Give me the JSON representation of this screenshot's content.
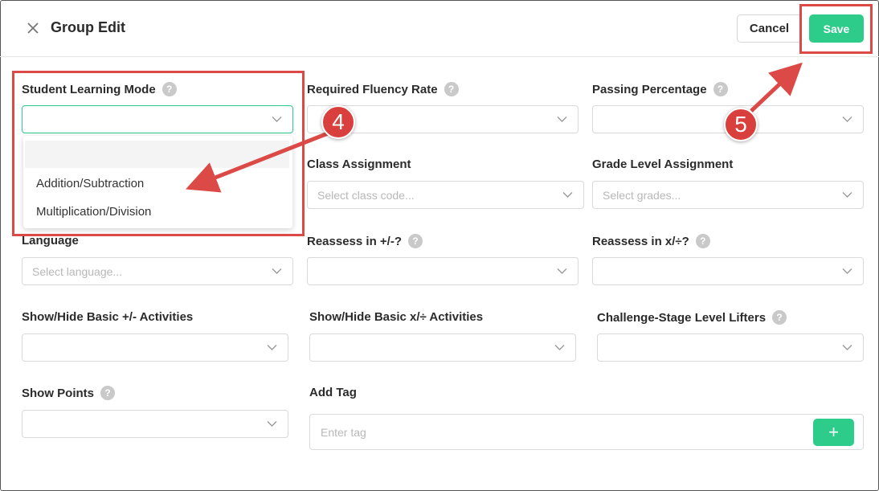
{
  "header": {
    "title": "Group Edit",
    "cancel_label": "Cancel",
    "save_label": "Save"
  },
  "fields": {
    "student_learning_mode": {
      "label": "Student Learning Mode",
      "help": "?",
      "value": ""
    },
    "required_fluency_rate": {
      "label": "Required Fluency Rate",
      "help": "?",
      "value": ""
    },
    "passing_percentage": {
      "label": "Passing Percentage",
      "help": "?",
      "value": ""
    },
    "class_assignment": {
      "label": "Class Assignment",
      "placeholder": "Select class code..."
    },
    "grade_level_assignment": {
      "label": "Grade Level Assignment",
      "placeholder": "Select grades..."
    },
    "language": {
      "label": "Language",
      "placeholder": "Select language..."
    },
    "reassess_add_sub": {
      "label": "Reassess in +/-?",
      "help": "?",
      "value": ""
    },
    "reassess_mul_div": {
      "label": "Reassess in x/÷?",
      "help": "?",
      "value": ""
    },
    "show_hide_basic_add_sub": {
      "label": "Show/Hide Basic +/- Activities",
      "value": ""
    },
    "show_hide_basic_mul_div": {
      "label": "Show/Hide Basic x/÷ Activities",
      "value": ""
    },
    "challenge_stage_level_lifters": {
      "label": "Challenge-Stage Level Lifters",
      "help": "?",
      "value": ""
    },
    "show_points": {
      "label": "Show Points",
      "help": "?",
      "value": ""
    },
    "add_tag": {
      "label": "Add Tag",
      "placeholder": "Enter tag",
      "button": "+"
    }
  },
  "dropdown": {
    "options": [
      "",
      "Addition/Subtraction",
      "Multiplication/Division"
    ]
  },
  "annotations": {
    "step_4": "4",
    "step_5": "5",
    "color": "#dc4a47"
  },
  "colors": {
    "accent": "#2ecc8b",
    "annotation": "#dc4a47"
  }
}
